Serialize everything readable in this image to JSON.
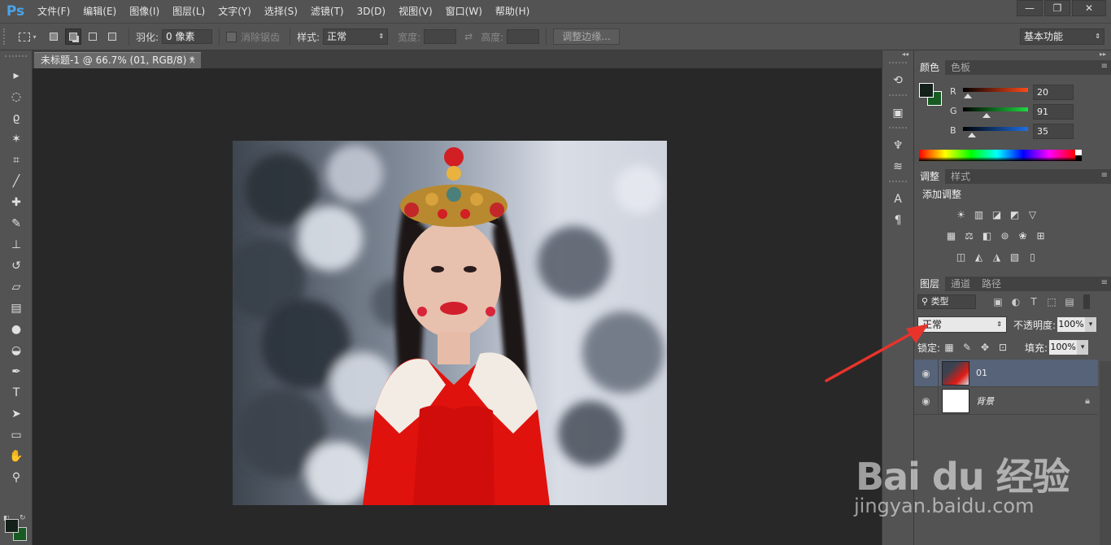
{
  "app": {
    "logo": "Ps"
  },
  "menu": [
    "文件(F)",
    "编辑(E)",
    "图像(I)",
    "图层(L)",
    "文字(Y)",
    "选择(S)",
    "滤镜(T)",
    "3D(D)",
    "视图(V)",
    "窗口(W)",
    "帮助(H)"
  ],
  "window_controls": {
    "minimize": "—",
    "restore": "❐",
    "close": "✕"
  },
  "options": {
    "feather_label": "羽化:",
    "feather_value": "0 像素",
    "antialias_label": "消除锯齿",
    "style_label": "样式:",
    "style_value": "正常",
    "width_label": "宽度:",
    "height_label": "高度:",
    "refine_edge": "调整边缘...",
    "workspace": "基本功能"
  },
  "document": {
    "tab_title": "未标题-1 @ 66.7% (01, RGB/8) *",
    "tab_close": "×"
  },
  "color_panel": {
    "tabs": [
      "颜色",
      "色板"
    ],
    "foreground": "#14201a",
    "background": "#175b23",
    "channels": [
      {
        "label": "R",
        "value": "20",
        "fraction": 0.078,
        "gradient": "#ff4a1a"
      },
      {
        "label": "G",
        "value": "91",
        "fraction": 0.357,
        "gradient": "#1fd940"
      },
      {
        "label": "B",
        "value": "35",
        "fraction": 0.137,
        "gradient": "#1f6fe6"
      }
    ]
  },
  "adjustments_panel": {
    "tabs": [
      "调整",
      "样式"
    ],
    "title": "添加调整"
  },
  "layers_panel": {
    "tabs": [
      "图层",
      "通道",
      "路径"
    ],
    "filter_kind": "类型",
    "blend_mode": "正常",
    "opacity_label": "不透明度:",
    "opacity_value": "100%",
    "lock_label": "锁定:",
    "fill_label": "填充:",
    "fill_value": "100%",
    "layers": [
      {
        "name": "01",
        "selected": true,
        "locked": false
      },
      {
        "name": "背景",
        "selected": false,
        "locked": true
      }
    ]
  },
  "watermark": {
    "logo": "Bai du 经验",
    "url": "jingyan.baidu.com"
  }
}
